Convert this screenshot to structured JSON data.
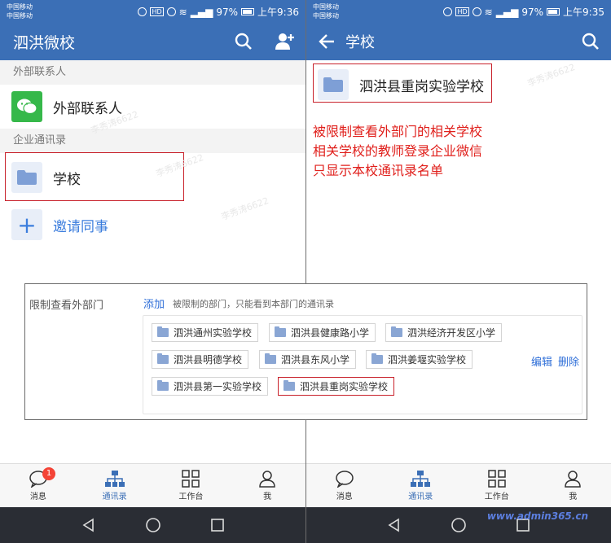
{
  "status_left": {
    "carrier1": "中国移动",
    "carrier2": "中国移动",
    "battery": "97%",
    "time": "上午9:36"
  },
  "status_right": {
    "carrier1": "中国移动",
    "carrier2": "中国移动",
    "battery": "97%",
    "time": "上午9:35"
  },
  "left_screen": {
    "app_title": "泗洪微校",
    "section_external": "外部联系人",
    "external_contacts": "外部联系人",
    "section_directory": "企业通讯录",
    "school_item": "学校",
    "invite": "邀请同事",
    "watermark": "李秀涛6622"
  },
  "right_screen": {
    "title": "学校",
    "school_item": "泗洪县重岗实验学校",
    "note_lines": [
      "被限制查看外部门的相关学校",
      "相关学校的教师登录企业微信",
      "只显示本校通讯录名单"
    ],
    "watermark": "李秀涛6622"
  },
  "tabs": [
    {
      "label": "消息",
      "badge": "1"
    },
    {
      "label": "通讯录"
    },
    {
      "label": "工作台"
    },
    {
      "label": "我"
    }
  ],
  "overlay": {
    "label": "限制查看外部门",
    "add": "添加",
    "hint": "被限制的部门，只能看到本部门的通讯录",
    "departments": [
      "泗洪通州实验学校",
      "泗洪县健康路小学",
      "泗洪经济开发区小学",
      "泗洪县明德学校",
      "泗洪县东风小学",
      "泗洪姜堰实验学校",
      "泗洪县第一实验学校",
      "泗洪县重岗实验学校"
    ],
    "edit": "编辑",
    "delete": "删除"
  },
  "watermark_site": "www.admin365.cn",
  "colors": {
    "header": "#3b6fb6",
    "accent": "#3b7ddd",
    "highlight": "#c8202a",
    "note": "#e0201c"
  }
}
